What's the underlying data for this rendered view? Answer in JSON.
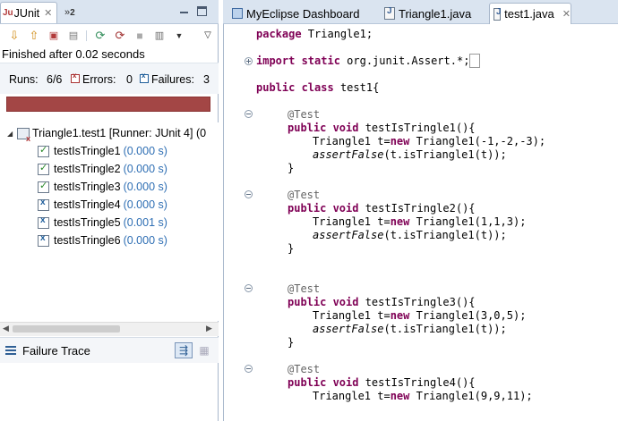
{
  "left": {
    "tab_label": "JUnit",
    "tab_more": "»",
    "tab_more_count": "2",
    "finished": "Finished after 0.02 seconds",
    "runs_label": "Runs:",
    "runs_value": "6/6",
    "errors_label": "Errors:",
    "errors_value": "0",
    "failures_label": "Failures:",
    "failures_value": "3",
    "progress_fraction": 1.0,
    "progress_color": "#a34645",
    "suite_label": "Triangle1.test1 [Runner: JUnit 4] (0",
    "tests": [
      {
        "name": "testIsTringle1",
        "time": "(0.000 s)",
        "status": "pass"
      },
      {
        "name": "testIsTringle2",
        "time": "(0.000 s)",
        "status": "pass"
      },
      {
        "name": "testIsTringle3",
        "time": "(0.000 s)",
        "status": "pass"
      },
      {
        "name": "testIsTringle4",
        "time": "(0.000 s)",
        "status": "fail"
      },
      {
        "name": "testIsTringle5",
        "time": "(0.001 s)",
        "status": "fail"
      },
      {
        "name": "testIsTringle6",
        "time": "(0.000 s)",
        "status": "fail"
      }
    ],
    "failure_trace_label": "Failure Trace"
  },
  "editor": {
    "tabs": [
      {
        "label": "MyEclipse Dashboard"
      },
      {
        "label": "Triangle1.java"
      },
      {
        "label": "test1.java"
      }
    ],
    "code": {
      "l1_kw": "package",
      "l1_rest": " Triangle1;",
      "l2_kw1": "import",
      "l2_kw2": " static",
      "l2_rest": " org.junit.Assert.*;",
      "l3_kw1": "public",
      "l3_kw2": " class",
      "l3_rest": " test1{",
      "t1_ann": "@Test",
      "t1_kw1": "public",
      "t1_kw2": " void",
      "t1_sig": " testIsTringle1(){",
      "t1_body1a": "Triangle1 t=",
      "t1_body1kw": "new",
      "t1_body1b": " Triangle1(-1,-2,-3);",
      "t1_assert": "assertFalse",
      "t1_assert_rest": "(t.isTriangle1(t));",
      "close": "}",
      "t2_ann": "@Test",
      "t2_sig": " testIsTringle2(){",
      "t2_body1b": " Triangle1(1,1,3);",
      "t3_ann": "@Test",
      "t3_sig": " testIsTringle3(){",
      "t3_body1b": " Triangle1(3,0,5);",
      "t4_ann": "@Test",
      "t4_sig": " testIsTringle4(){",
      "t4_body1b": " Triangle1(9,9,11);"
    }
  }
}
